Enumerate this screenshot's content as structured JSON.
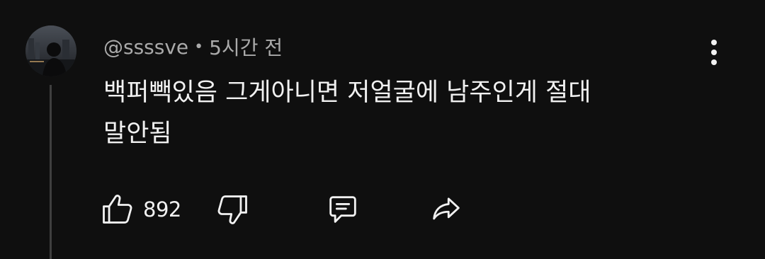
{
  "comment": {
    "author": "@ssssve",
    "separator": "•",
    "time": "5시간 전",
    "text": "백퍼빽있음 그게아니면 저얼굴에 남주인게 절대\n말안됨",
    "like_count": "892"
  },
  "icons": {
    "like": "thumb-up-icon",
    "dislike": "thumb-down-icon",
    "reply": "comment-icon",
    "share": "share-icon",
    "more": "more-vertical-icon"
  },
  "colors": {
    "background": "#0f0f0f",
    "primary_text": "#f1f1f1",
    "secondary_text": "#aaaaaa",
    "thread_line": "#3f3f3f"
  }
}
